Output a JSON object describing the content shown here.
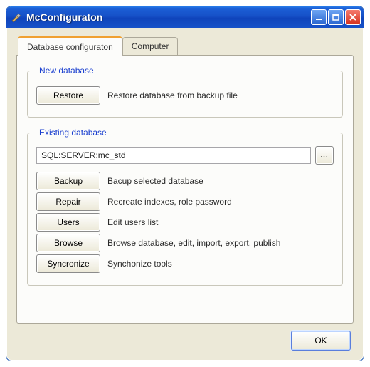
{
  "window": {
    "title": "McConfiguraton"
  },
  "tabs": [
    {
      "label": "Database configuraton",
      "active": true
    },
    {
      "label": "Computer",
      "active": false
    }
  ],
  "groups": {
    "new_db": {
      "legend": "New database",
      "restore_btn": "Restore",
      "restore_desc": "Restore database from backup file"
    },
    "existing_db": {
      "legend": "Existing database",
      "connection": "SQL:SERVER:mc_std",
      "ellipsis": "...",
      "rows": [
        {
          "btn": "Backup",
          "desc": "Bacup selected database"
        },
        {
          "btn": "Repair",
          "desc": "Recreate indexes, role password"
        },
        {
          "btn": "Users",
          "desc": "Edit users list"
        },
        {
          "btn": "Browse",
          "desc": "Browse database, edit, import, export, publish"
        },
        {
          "btn": "Syncronize",
          "desc": "Synchonize tools"
        }
      ]
    }
  },
  "footer": {
    "ok": "OK"
  }
}
